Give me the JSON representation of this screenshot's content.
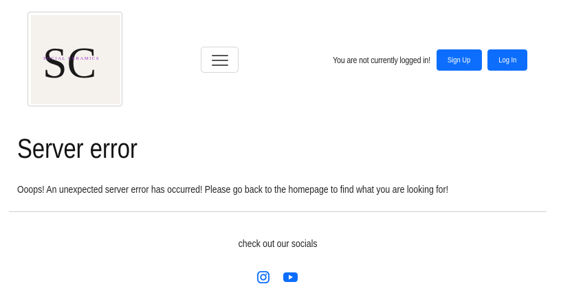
{
  "header": {
    "logo": {
      "monogram": "SC",
      "wordmark": "SOCIAL CERAMICS",
      "alt": "Social Ceramics logo"
    },
    "nav_toggle_label": "Toggle navigation",
    "login_status": "You are not currently logged in!",
    "signup_label": "Sign Up",
    "login_label": "Log In"
  },
  "main": {
    "title": "Server error",
    "message": "Ooops! An unexpected server error has occurred! Please go back to the homepage to find what you are looking for!"
  },
  "footer": {
    "socials_title": "check out our socials",
    "socials": [
      {
        "name": "instagram",
        "icon": "instagram-icon"
      },
      {
        "name": "youtube",
        "icon": "youtube-icon"
      }
    ]
  },
  "colors": {
    "primary": "#0d6efd",
    "logo_bg": "#f5f1ec",
    "logo_accent": "#9b2fd1",
    "text": "#212529"
  }
}
